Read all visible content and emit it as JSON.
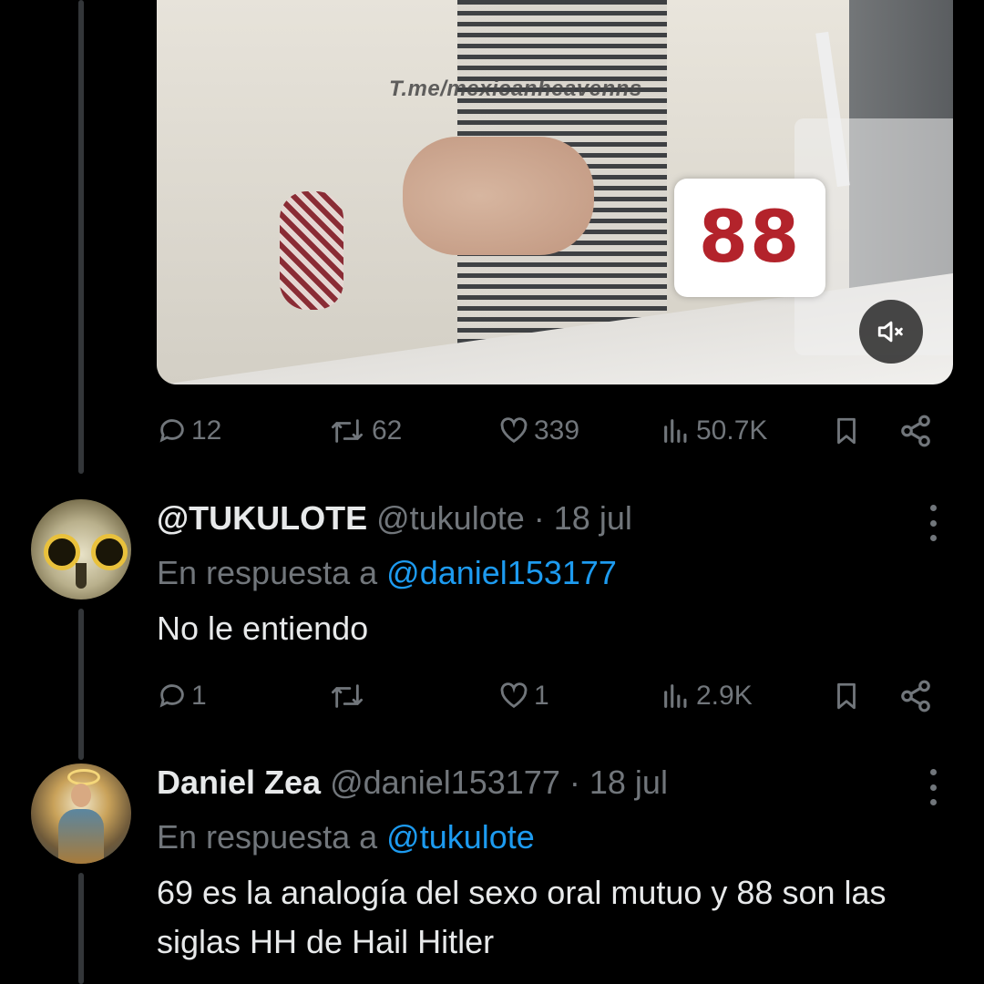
{
  "media": {
    "watermark": "T.me/mexicanheavenns",
    "badge_text": "88",
    "mute_icon": "speaker-muted-icon"
  },
  "main_tweet_actions": {
    "replies": "12",
    "reposts": "62",
    "likes": "339",
    "views": "50.7K"
  },
  "replies": [
    {
      "display_name": "@TUKULOTE",
      "handle": "@tukulote",
      "separator": "·",
      "date": "18 jul",
      "reply_prefix": "En respuesta a",
      "reply_to": "@daniel153177",
      "text": "No le entiendo",
      "actions": {
        "replies": "1",
        "reposts": "",
        "likes": "1",
        "views": "2.9K"
      }
    },
    {
      "display_name": "Daniel Zea",
      "handle": "@daniel153177",
      "separator": "·",
      "date": "18 jul",
      "reply_prefix": "En respuesta a",
      "reply_to": "@tukulote",
      "text": "69 es la analogía del sexo oral mutuo y 88 son las siglas HH de Hail Hitler"
    }
  ],
  "colors": {
    "background": "#000000",
    "text": "#e7e9ea",
    "muted": "#71767b",
    "link": "#1d9bf0",
    "badge_red": "#b3232b"
  }
}
